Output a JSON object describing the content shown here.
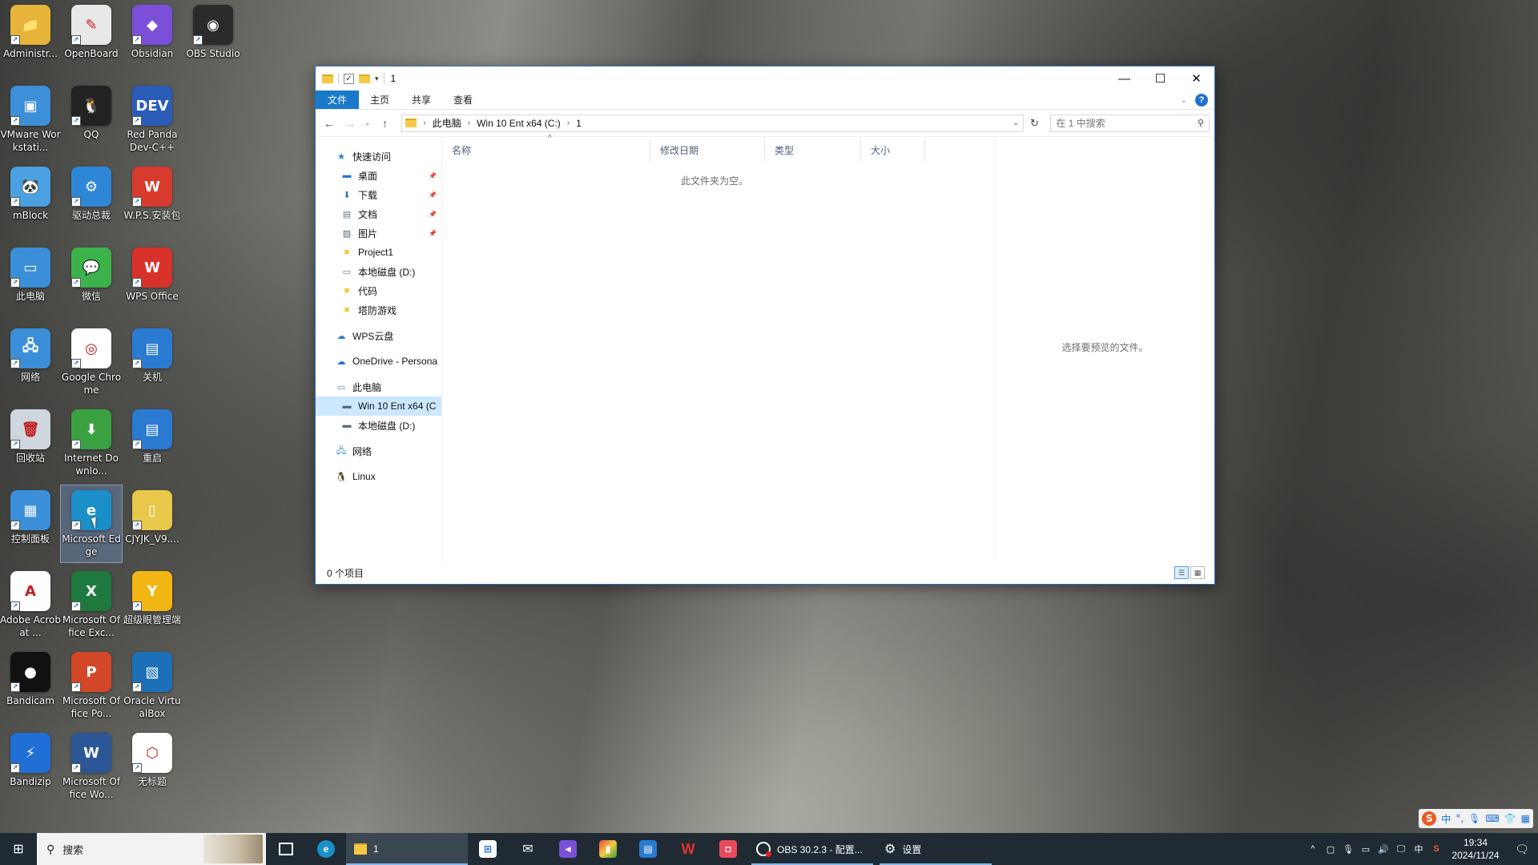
{
  "desktop": {
    "icons": [
      {
        "label": "Administr...",
        "color": "#e7b43a",
        "glyph": "📁"
      },
      {
        "label": "OpenBoard",
        "color": "#e8e8e8",
        "glyph": "✎"
      },
      {
        "label": "Obsidian",
        "color": "#7b4fd8",
        "glyph": "◆"
      },
      {
        "label": "OBS Studio",
        "color": "#2b2b2b",
        "glyph": "◉"
      },
      {
        "label": "VMware Workstati...",
        "color": "#3d8fd8",
        "glyph": "▣"
      },
      {
        "label": "QQ",
        "color": "#222222",
        "glyph": "🐧"
      },
      {
        "label": "Red Panda Dev-C++",
        "color": "#2a5cb8",
        "glyph": "DEV"
      },
      {
        "label": "mBlock",
        "color": "#4aa0e0",
        "glyph": "🐼"
      },
      {
        "label": "驱动总裁",
        "color": "#2d86d6",
        "glyph": "⚙"
      },
      {
        "label": "W.P.S.安装包",
        "color": "#d83a2e",
        "glyph": "W"
      },
      {
        "label": "此电脑",
        "color": "#3b8fd8",
        "glyph": "▭"
      },
      {
        "label": "微信",
        "color": "#3cb34a",
        "glyph": "💬"
      },
      {
        "label": "WPS Office",
        "color": "#d8322b",
        "glyph": "W"
      },
      {
        "label": "网络",
        "color": "#3b8fd8",
        "glyph": "🖧"
      },
      {
        "label": "Google Chrome",
        "color": "#ffffff",
        "glyph": "◎"
      },
      {
        "label": "关机",
        "color": "#2a7ad2",
        "glyph": "▤"
      },
      {
        "label": "回收站",
        "color": "#d0d6de",
        "glyph": "🗑"
      },
      {
        "label": "Internet Downlo...",
        "color": "#3aa140",
        "glyph": "⬇"
      },
      {
        "label": "重启",
        "color": "#2a7ad2",
        "glyph": "▤"
      },
      {
        "label": "控制面板",
        "color": "#3b8fd8",
        "glyph": "▦"
      },
      {
        "label": "Microsoft Edge",
        "color": "#1a8fc8",
        "glyph": "e"
      },
      {
        "label": "CJYJK_V9....",
        "color": "#e8c84a",
        "glyph": "▯"
      },
      {
        "label": "Adobe Acrobat ...",
        "color": "#ffffff",
        "glyph": "A"
      },
      {
        "label": "Microsoft Office Exc...",
        "color": "#1e7a3c",
        "glyph": "X"
      },
      {
        "label": "超级眼管理端",
        "color": "#f2b614",
        "glyph": "Y"
      },
      {
        "label": "Bandicam",
        "color": "#111111",
        "glyph": "●"
      },
      {
        "label": "Microsoft Office Po...",
        "color": "#d24726",
        "glyph": "P"
      },
      {
        "label": "Oracle VirtualBox",
        "color": "#1d6fb8",
        "glyph": "▧"
      },
      {
        "label": "Bandizip",
        "color": "#1f6fd6",
        "glyph": "⚡"
      },
      {
        "label": "Microsoft Office Wo...",
        "color": "#2b5797",
        "glyph": "W"
      },
      {
        "label": "无标题",
        "color": "#ffffff",
        "glyph": "⬡"
      }
    ]
  },
  "explorer": {
    "title": "1",
    "window_buttons": {
      "minimize": "—",
      "maximize": "☐",
      "close": "✕"
    },
    "ribbon_tabs": [
      "文件",
      "主页",
      "共享",
      "查看"
    ],
    "address": {
      "crumbs": [
        "此电脑",
        "Win 10 Ent x64 (C:)",
        "1"
      ]
    },
    "search": {
      "placeholder": "在 1 中搜索"
    },
    "nav": {
      "quick_access": "快速访问",
      "pinned": [
        {
          "label": "桌面",
          "glyph": "▬",
          "color": "#2a7ad2"
        },
        {
          "label": "下载",
          "glyph": "⬇",
          "color": "#2a7ad2"
        },
        {
          "label": "文档",
          "glyph": "▤",
          "color": "#6a7a8a"
        },
        {
          "label": "图片",
          "glyph": "▨",
          "color": "#5a6a7a"
        }
      ],
      "recent": [
        {
          "label": "Project1",
          "glyph": "■",
          "color": "#f5c945"
        },
        {
          "label": "本地磁盘 (D:)",
          "glyph": "▭",
          "color": "#6a7a8a"
        },
        {
          "label": "代码",
          "glyph": "■",
          "color": "#f5c945"
        },
        {
          "label": "塔防游戏",
          "glyph": "■",
          "color": "#f5c945"
        }
      ],
      "wps_cloud": "WPS云盘",
      "onedrive": "OneDrive - Persona",
      "this_pc": "此电脑",
      "drives": [
        "Win 10 Ent x64 (C",
        "本地磁盘 (D:)"
      ],
      "network": "网络",
      "linux": "Linux"
    },
    "columns": [
      "名称",
      "修改日期",
      "类型",
      "大小"
    ],
    "empty_message": "此文件夹为空。",
    "preview_message": "选择要预览的文件。",
    "status": "0 个项目"
  },
  "taskbar": {
    "search_text": "搜索",
    "explorer_label": "1",
    "obs_label": "OBS 30.2.3 - 配置...",
    "settings_label": "设置",
    "ime": "中",
    "time": "19:34",
    "date": "2024/11/24"
  },
  "ime_bar": {
    "lang": "中"
  }
}
